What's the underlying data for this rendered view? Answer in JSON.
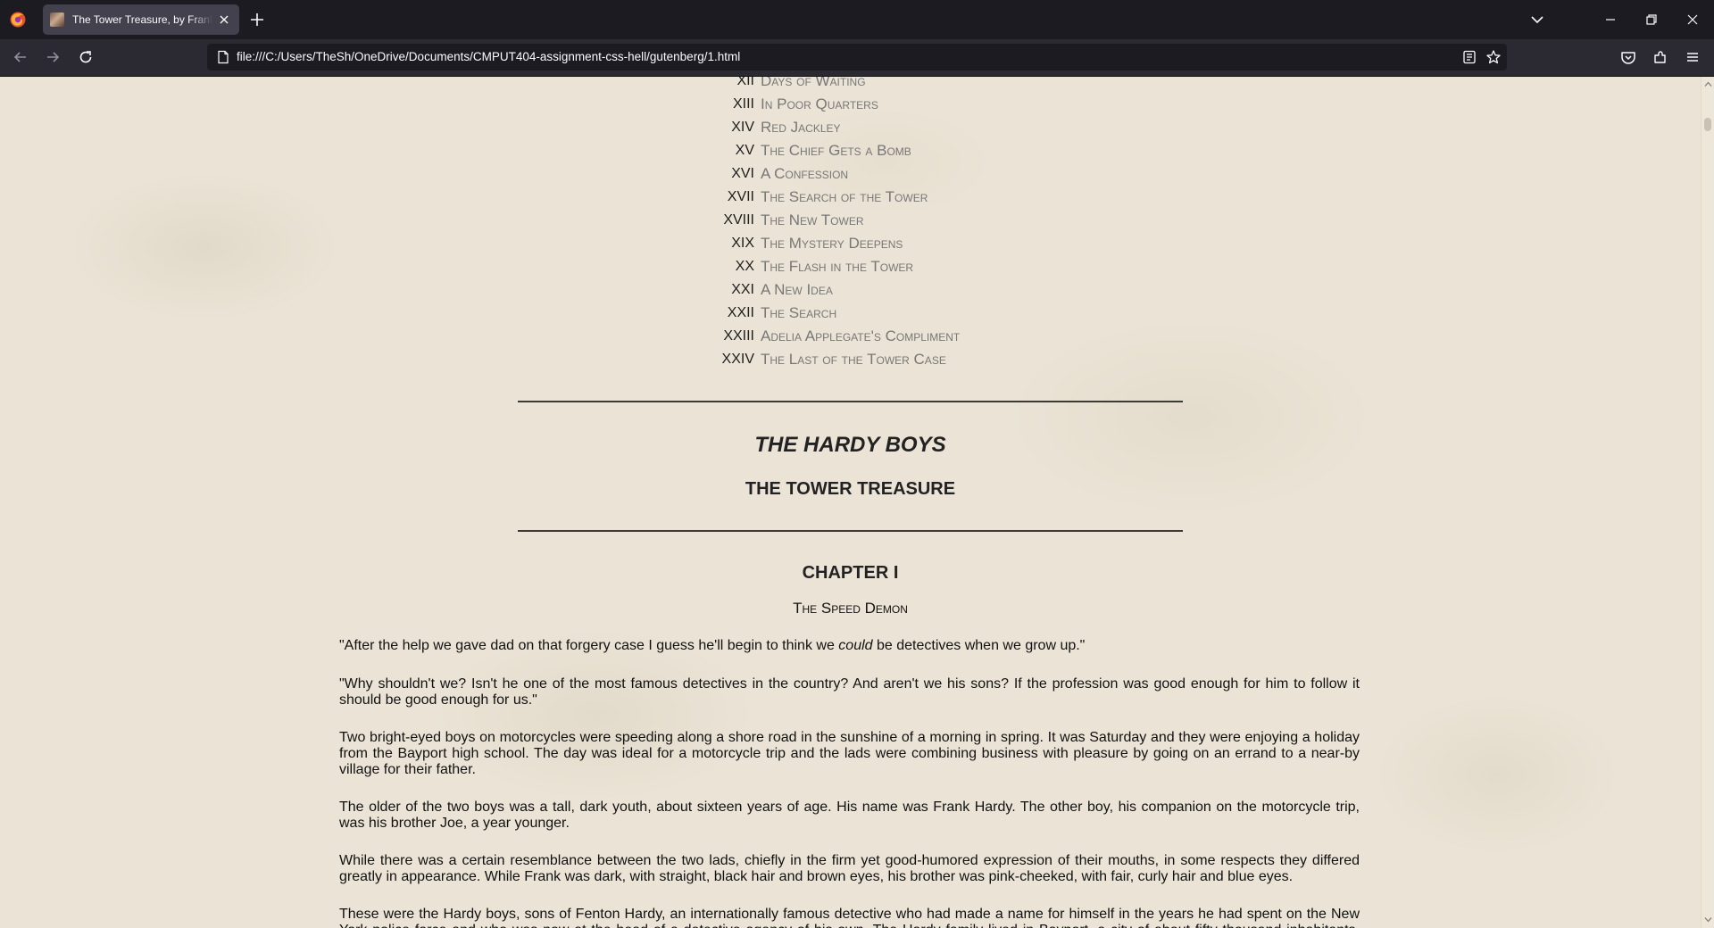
{
  "browser": {
    "tab_title": "The Tower Treasure, by Franklin W. Dixon",
    "url": "file:///C:/Users/TheSh/OneDrive/Documents/CMPUT404-assignment-css-hell/gutenberg/1.html"
  },
  "toc": [
    {
      "num": "XII",
      "title": "Days of Waiting"
    },
    {
      "num": "XIII",
      "title": "In Poor Quarters"
    },
    {
      "num": "XIV",
      "title": "Red Jackley"
    },
    {
      "num": "XV",
      "title": "The Chief Gets a Bomb"
    },
    {
      "num": "XVI",
      "title": "A Confession"
    },
    {
      "num": "XVII",
      "title": "The Search of the Tower"
    },
    {
      "num": "XVIII",
      "title": "The New Tower"
    },
    {
      "num": "XIX",
      "title": "The Mystery Deepens"
    },
    {
      "num": "XX",
      "title": "The Flash in the Tower"
    },
    {
      "num": "XXI",
      "title": "A New Idea"
    },
    {
      "num": "XXII",
      "title": "The Search"
    },
    {
      "num": "XXIII",
      "title": "Adelia Applegate's Compliment"
    },
    {
      "num": "XXIV",
      "title": "The Last of the Tower Case"
    }
  ],
  "book": {
    "series": "THE HARDY BOYS",
    "title": "THE TOWER TREASURE"
  },
  "chapter": {
    "number": "CHAPTER I",
    "name": "The Speed Demon",
    "p1_before": "\"After the help we gave dad on that forgery case I guess he'll begin to think we ",
    "p1_em": "could",
    "p1_after": " be detectives when we grow up.\"",
    "p2": "\"Why shouldn't we? Isn't he one of the most famous detectives in the country? And aren't we his sons? If the profession was good enough for him to follow it should be good enough for us.\"",
    "p3": "Two bright-eyed boys on motorcycles were speeding along a shore road in the sunshine of a morning in spring. It was Saturday and they were enjoying a holiday from the Bayport high school. The day was ideal for a motorcycle trip and the lads were combining business with pleasure by going on an errand to a near-by village for their father.",
    "p4": "The older of the two boys was a tall, dark youth, about sixteen years of age. His name was Frank Hardy. The other boy, his companion on the motorcycle trip, was his brother Joe, a year younger.",
    "p5": "While there was a certain resemblance between the two lads, chiefly in the firm yet good-humored expression of their mouths, in some respects they differed greatly in appearance. While Frank was dark, with straight, black hair and brown eyes, his brother was pink-cheeked, with fair, curly hair and blue eyes.",
    "p6": "These were the Hardy boys, sons of Fenton Hardy, an internationally famous detective who had made a name for himself in the years he had spent on the New York police force and who was now at the head of a detective agency of his own. The Hardy family lived in Bayport, a city of about fifty thousand inhabitants, located on Barmet Bay."
  }
}
